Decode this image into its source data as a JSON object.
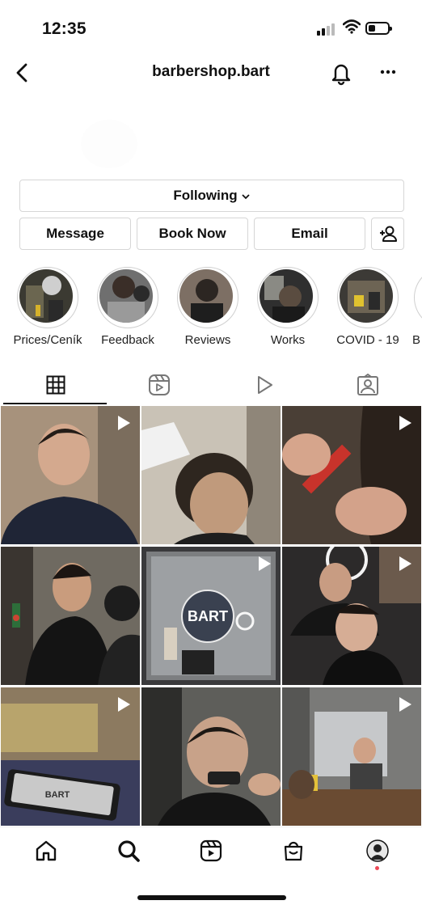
{
  "status": {
    "time": "12:35"
  },
  "header": {
    "username": "barbershop.bart"
  },
  "buttons": {
    "following": "Following",
    "message": "Message",
    "book_now": "Book Now",
    "email": "Email"
  },
  "highlights": [
    {
      "label": "Prices/Ceník"
    },
    {
      "label": "Feedback"
    },
    {
      "label": "Reviews"
    },
    {
      "label": "Works"
    },
    {
      "label": "COVID - 19"
    },
    {
      "label": "B"
    }
  ],
  "tabs": [
    "grid-icon",
    "reels-icon",
    "video-icon",
    "tagged-icon"
  ],
  "posts": [
    {
      "type": "reel",
      "overlay": ""
    },
    {
      "type": "photo",
      "overlay": ""
    },
    {
      "type": "reel",
      "overlay": ""
    },
    {
      "type": "photo",
      "overlay": ""
    },
    {
      "type": "reel",
      "overlay": "BART"
    },
    {
      "type": "reel",
      "overlay": ""
    },
    {
      "type": "reel",
      "overlay": "BART"
    },
    {
      "type": "photo",
      "overlay": ""
    },
    {
      "type": "reel",
      "overlay": ""
    }
  ],
  "bottom_nav": [
    "home-icon",
    "search-icon",
    "reels-icon",
    "shop-icon",
    "profile-avatar"
  ],
  "colors": {
    "notification_dot": "#ed4956",
    "text": "#111111",
    "border": "#d6d6d6"
  }
}
